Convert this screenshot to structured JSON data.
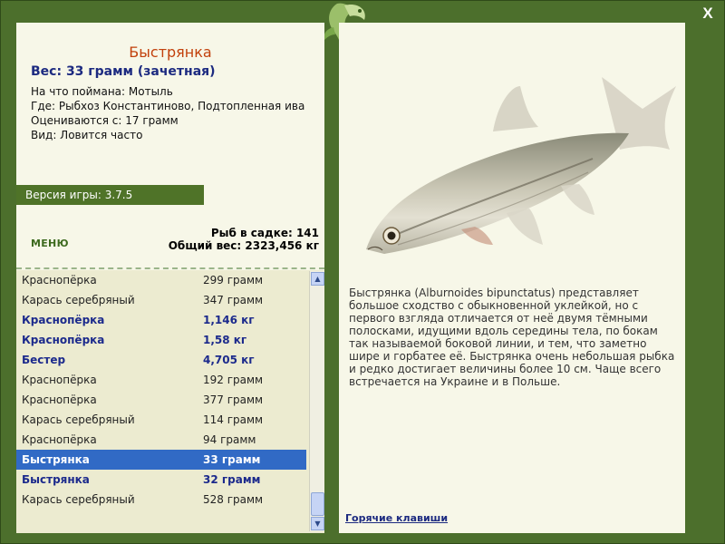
{
  "app": {
    "close_label": "X",
    "version": "Версия игры: 3.7.5",
    "menu_label": "МЕНЮ"
  },
  "fish": {
    "name": "Быстрянка",
    "weight": "Вес: 33 грамм (зачетная)",
    "info": {
      "bait": "На что поймана: Мотыль",
      "place": "Где: Рыбхоз Константиново, Подтопленная ива",
      "rated_from": "Оцениваются с: 17 грамм",
      "kind": "Вид: Ловится часто"
    },
    "description": "Быстрянка (Alburnoides bipunctatus) представляет большое сходство с обыкновенной уклейкой, но с первого взгляда отличается от неё двумя тёмными полосками, идущими вдоль середины тела, по бокам так называемой боковой линии, и тем, что заметно шире и горбатее её. Быстрянка очень небольшая рыбка и редко достигает величины более 10 см. Чаще всего встречается на Украине и в Польше."
  },
  "stats": {
    "count": "Рыб в садке: 141",
    "total_weight": "Общий вес: 2323,456 кг"
  },
  "catch_list": [
    {
      "name": "Краснопёрка",
      "weight": "299 грамм",
      "style": "normal"
    },
    {
      "name": "Карась серебряный",
      "weight": "347 грамм",
      "style": "normal"
    },
    {
      "name": "Краснопёрка",
      "weight": "1,146 кг",
      "style": "bold"
    },
    {
      "name": "Краснопёрка",
      "weight": "1,58 кг",
      "style": "bold"
    },
    {
      "name": "Бестер",
      "weight": "4,705 кг",
      "style": "bold"
    },
    {
      "name": "Краснопёрка",
      "weight": "192 грамм",
      "style": "normal"
    },
    {
      "name": "Краснопёрка",
      "weight": "377 грамм",
      "style": "normal"
    },
    {
      "name": "Карась серебряный",
      "weight": "114 грамм",
      "style": "normal"
    },
    {
      "name": "Краснопёрка",
      "weight": "94 грамм",
      "style": "normal"
    },
    {
      "name": "Быстрянка",
      "weight": "33 грамм",
      "style": "selected"
    },
    {
      "name": "Быстрянка",
      "weight": "32 грамм",
      "style": "bold"
    },
    {
      "name": "Карась серебряный",
      "weight": "528 грамм",
      "style": "normal"
    }
  ],
  "footer": {
    "hotkeys": "Горячие клавиши"
  },
  "colors": {
    "frame": "#4c6f2c",
    "panel": "#f7f7e8",
    "list_bg": "#ecebd0",
    "selected_row": "#316ac5",
    "title": "#c2410c",
    "accent_blue": "#1c2a80"
  }
}
